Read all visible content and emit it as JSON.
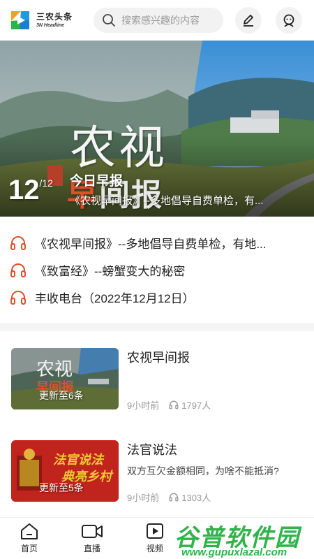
{
  "header": {
    "logo_cn": "三农头条",
    "logo_en": "3N Headline",
    "search_placeholder": "搜索感兴趣的内容"
  },
  "banner": {
    "title_cn": "农视",
    "subtitle_cn_red": "早",
    "subtitle_cn_rest": "间报",
    "page_current": "12",
    "page_total": "/12",
    "title": "今日早报",
    "description": "《农视早间报》--多地倡导自费单检，有..."
  },
  "audio_items": [
    "《农视早间报》--多地倡导自费单检，有地...",
    "《致富经》--螃蟹变大的秘密",
    "丰收电台（2022年12月12日）"
  ],
  "programs": [
    {
      "title": "农视早间报",
      "description": "",
      "badge": "更新至6条",
      "time": "9小时前",
      "listeners": "1797人",
      "thumb_text_1": "农视",
      "thumb_text_2": "早间报"
    },
    {
      "title": "法官说法",
      "description": "双方互欠金额相同，为啥不能抵消?",
      "badge": "更新至5条",
      "time": "9小时前",
      "listeners": "1303人",
      "thumb_text_1": "法官说法",
      "thumb_text_2": "典亮乡村"
    }
  ],
  "tabbar": {
    "items": [
      "首页",
      "直播",
      "视频"
    ]
  },
  "watermark": {
    "cn": "谷普软件园",
    "en": "www.gupuxlazal.com"
  },
  "colors": {
    "accent_red": "#e0502a",
    "watermark_green": "#2fb34a"
  }
}
